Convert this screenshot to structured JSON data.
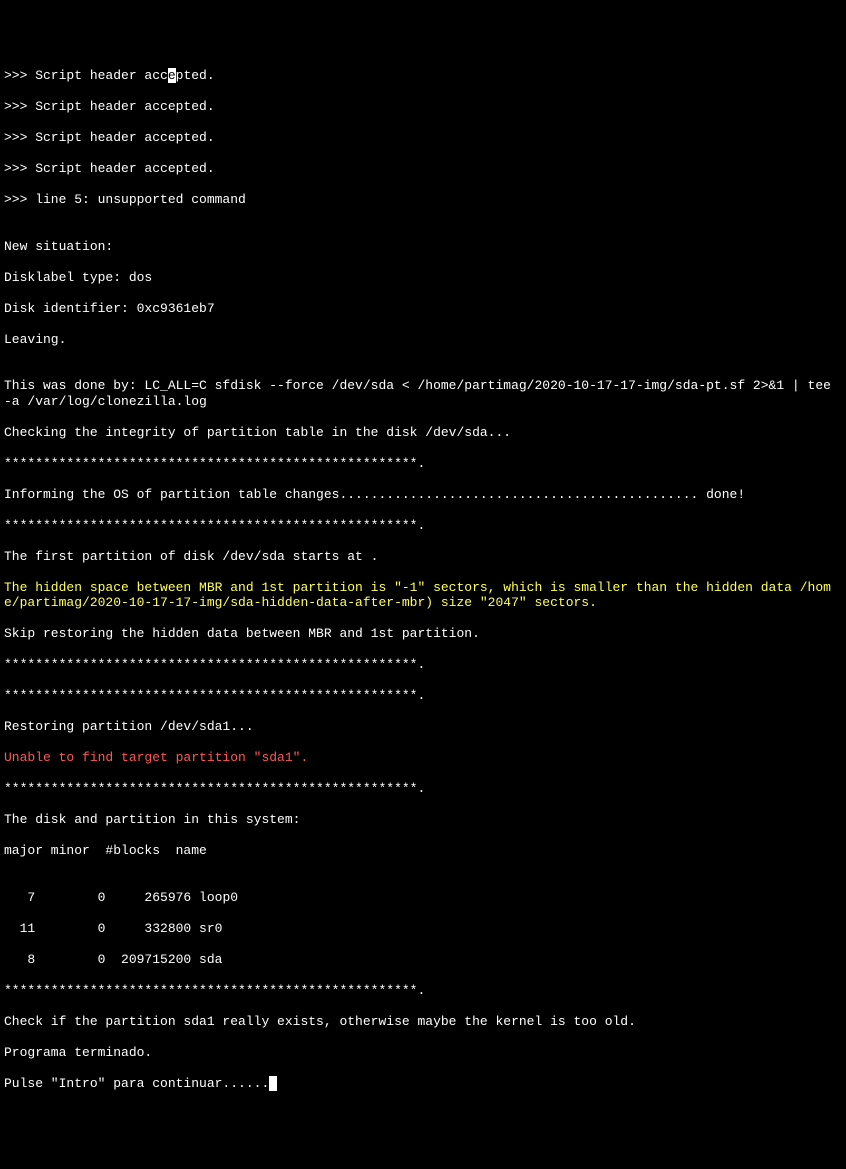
{
  "terminal": {
    "l1a": ">>> Script header acc",
    "l1b": "e",
    "l1c": "pted.",
    "l2": ">>> Script header accepted.",
    "l3": ">>> Script header accepted.",
    "l4": ">>> Script header accepted.",
    "l5": ">>> line 5: unsupported command",
    "l6": "",
    "l7": "New situation:",
    "l8": "Disklabel type: dos",
    "l9": "Disk identifier: 0xc9361eb7",
    "l10": "Leaving.",
    "l11": "",
    "l12": "This was done by: LC_ALL=C sfdisk --force /dev/sda < /home/partimag/2020-10-17-17-img/sda-pt.sf 2>&1 | tee -a /var/log/clonezilla.log",
    "l13": "Checking the integrity of partition table in the disk /dev/sda...",
    "l14": "*****************************************************.",
    "l15": "Informing the OS of partition table changes.............................................. done!",
    "l16": "*****************************************************.",
    "l17": "The first partition of disk /dev/sda starts at .",
    "l18": "The hidden space between MBR and 1st partition is \"-1\" sectors, which is smaller than the hidden data /home/partimag/2020-10-17-17-img/sda-hidden-data-after-mbr) size \"2047\" sectors.",
    "l19": "Skip restoring the hidden data between MBR and 1st partition.",
    "l20": "*****************************************************.",
    "l21": "*****************************************************.",
    "l22": "Restoring partition /dev/sda1...",
    "l23": "Unable to find target partition \"sda1\".",
    "l24": "*****************************************************.",
    "l25": "The disk and partition in this system:",
    "l26": "major minor  #blocks  name",
    "l27": "",
    "l28": "   7        0     265976 loop0",
    "l29": "  11        0     332800 sr0",
    "l30": "   8        0  209715200 sda",
    "l31": "*****************************************************.",
    "l32": "Check if the partition sda1 really exists, otherwise maybe the kernel is too old.",
    "l33": "Programa terminado.",
    "l34a": "Pulse \"Intro\" para continuar......",
    "l34b": " "
  }
}
